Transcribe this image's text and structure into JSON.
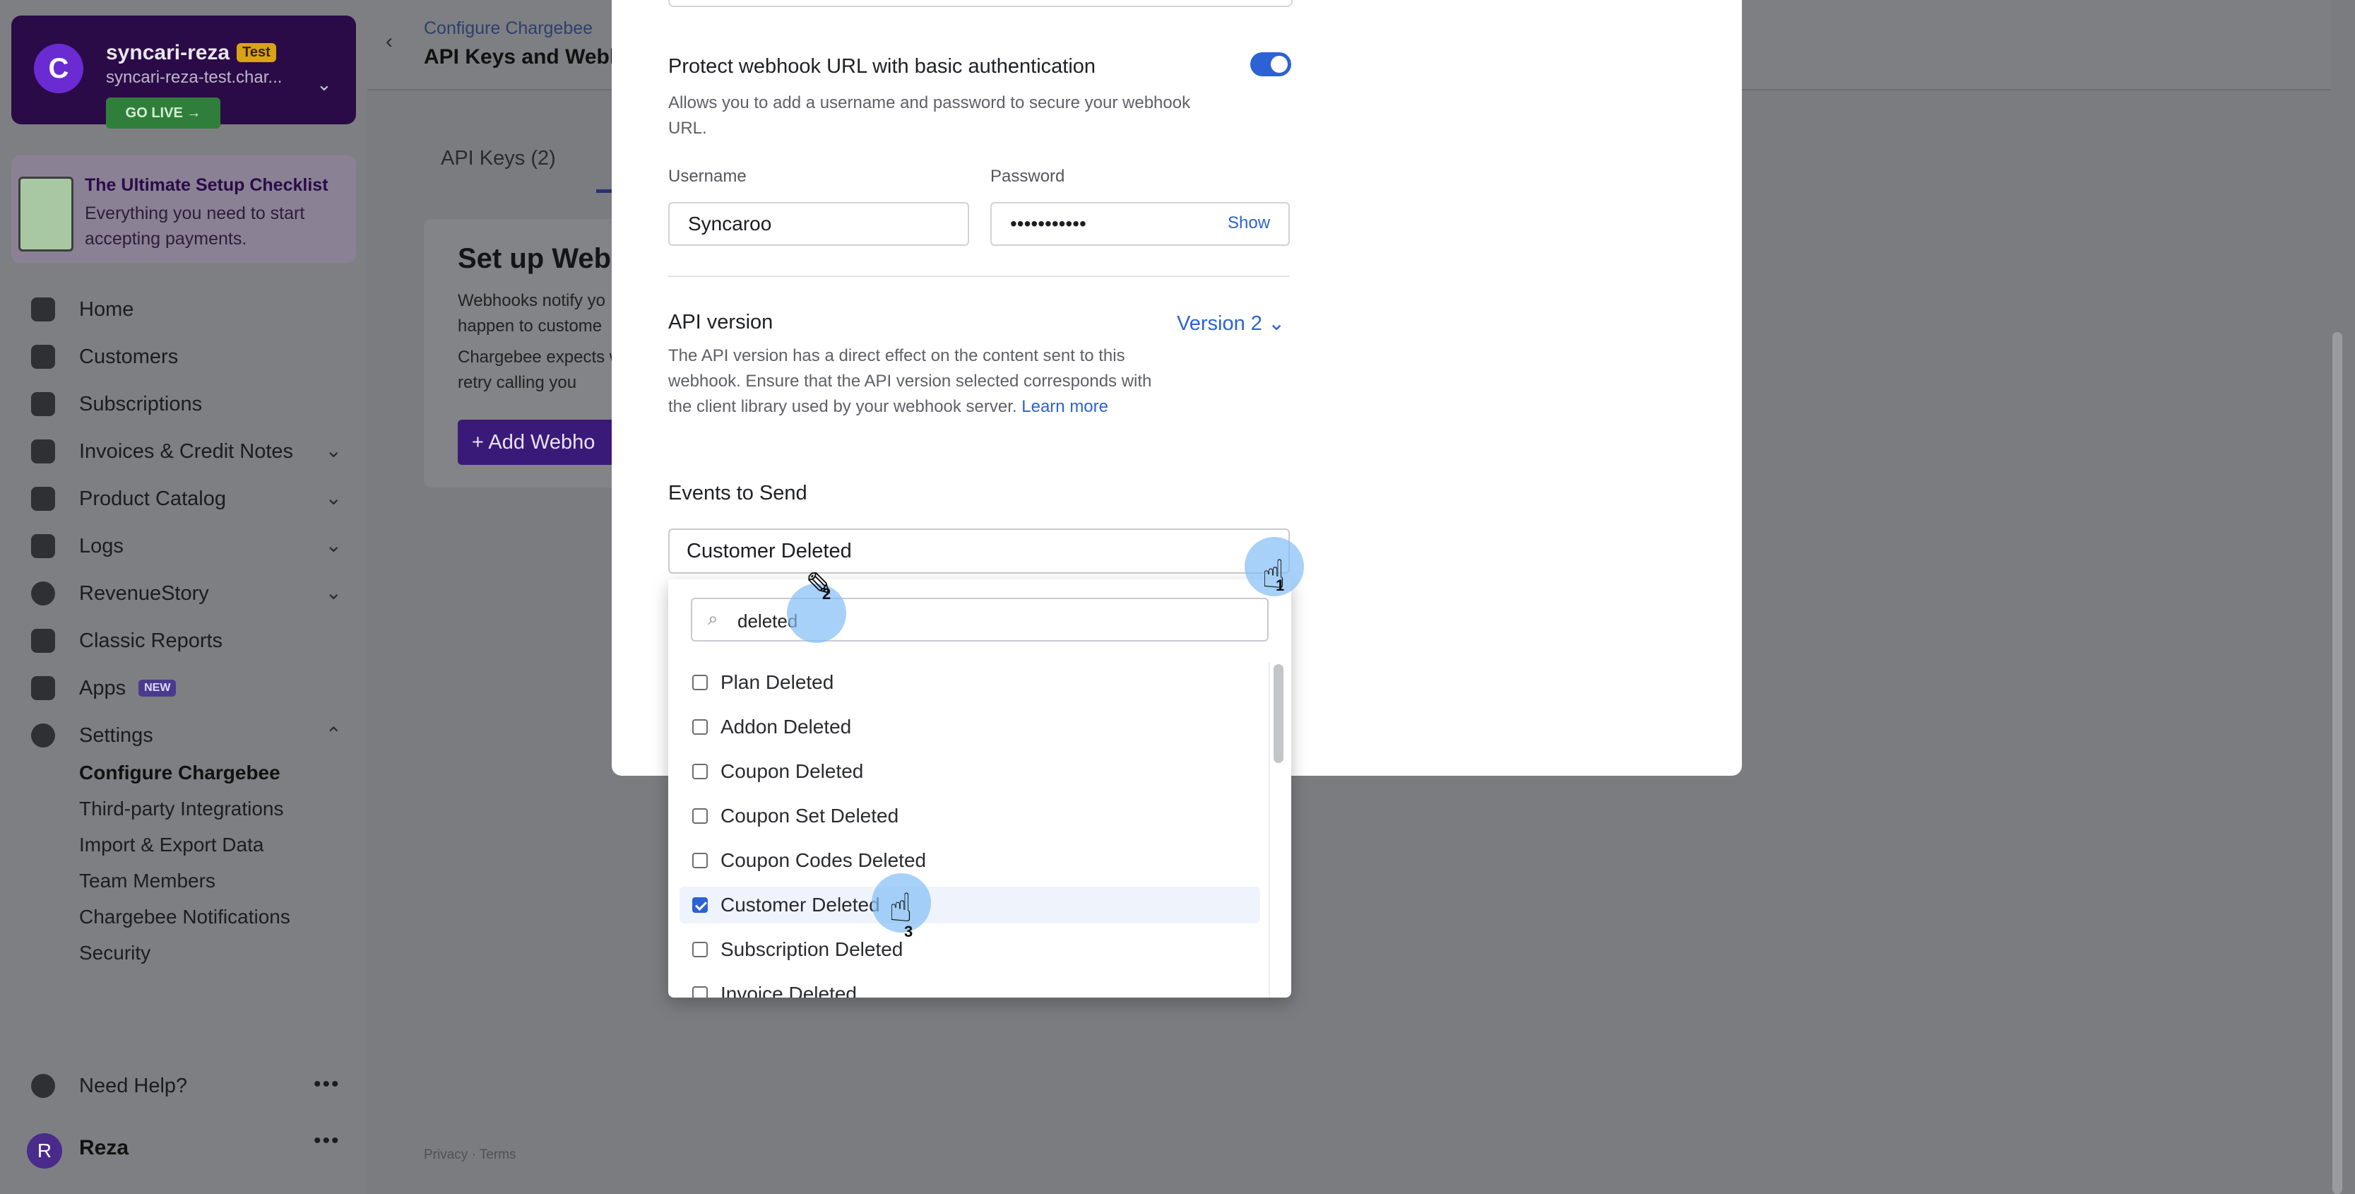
{
  "account": {
    "name": "syncari-reza",
    "badge": "Test",
    "subdomain": "syncari-reza-test.char...",
    "go_live": "GO LIVE →",
    "logo_letter": "C"
  },
  "checklist": {
    "title": "The Ultimate Setup Checklist",
    "text": "Everything you need to start accepting payments."
  },
  "nav": {
    "home": "Home",
    "customers": "Customers",
    "subscriptions": "Subscriptions",
    "invoices": "Invoices & Credit Notes",
    "product_catalog": "Product Catalog",
    "logs": "Logs",
    "revenue_story": "RevenueStory",
    "classic_reports": "Classic Reports",
    "apps": "Apps",
    "apps_badge": "NEW",
    "settings": "Settings",
    "settings_sub": [
      "Configure Chargebee",
      "Third-party Integrations",
      "Import & Export Data",
      "Team Members",
      "Chargebee Notifications",
      "Security"
    ],
    "need_help": "Need Help?",
    "user_initial": "R",
    "user_name": "Reza",
    "more": "•••"
  },
  "header": {
    "breadcrumb": "Configure Chargebee",
    "title": "API Keys and Webho"
  },
  "background": {
    "tab_api_keys": "API Keys (2)",
    "setup_title": "Set up Web",
    "setup_text_1": "Webhooks notify yo happen to custome",
    "setup_text_2": "Chargebee expects will retry calling you",
    "add_button": "+ Add Webho",
    "footer": "Privacy · Terms"
  },
  "modal": {
    "protect_label": "Protect webhook URL with basic authentication",
    "protect_help": "Allows you to add a username and password to secure your webhook URL.",
    "protect_enabled": true,
    "username_label": "Username",
    "username_value": "Syncaroo",
    "password_label": "Password",
    "password_value": "•••••••••••",
    "show_label": "Show",
    "api_version_label": "API version",
    "api_version_value": "Version 2",
    "api_help": "The API version has a direct effect on the content sent to this webhook. Ensure that the API version selected corresponds with the client library used by your webhook server.",
    "learn_more": "Learn more",
    "events_label": "Events to Send",
    "events_selected": "Customer Deleted"
  },
  "dropdown": {
    "search_value": "deleted",
    "items": [
      {
        "label": "Plan Deleted",
        "checked": false
      },
      {
        "label": "Addon Deleted",
        "checked": false
      },
      {
        "label": "Coupon Deleted",
        "checked": false
      },
      {
        "label": "Coupon Set Deleted",
        "checked": false
      },
      {
        "label": "Coupon Codes Deleted",
        "checked": false
      },
      {
        "label": "Customer Deleted",
        "checked": true
      },
      {
        "label": "Subscription Deleted",
        "checked": false
      },
      {
        "label": "Invoice Deleted",
        "checked": false
      }
    ]
  },
  "annotations": [
    "1",
    "2",
    "3"
  ]
}
